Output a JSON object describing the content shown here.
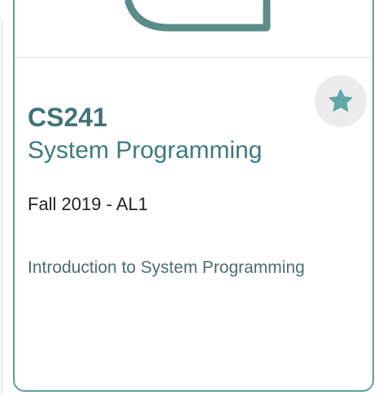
{
  "course_card": {
    "code": "CS241",
    "name": "System Programming",
    "term": "Fall 2019 - AL1",
    "description": "Introduction to System Programming",
    "favorite_icon": "star-icon",
    "favorited": true
  },
  "colors": {
    "accent": "#5f9ea3",
    "code_text": "#3f7279",
    "star": "#5fa8a6",
    "favorite_bg": "#ececec"
  }
}
